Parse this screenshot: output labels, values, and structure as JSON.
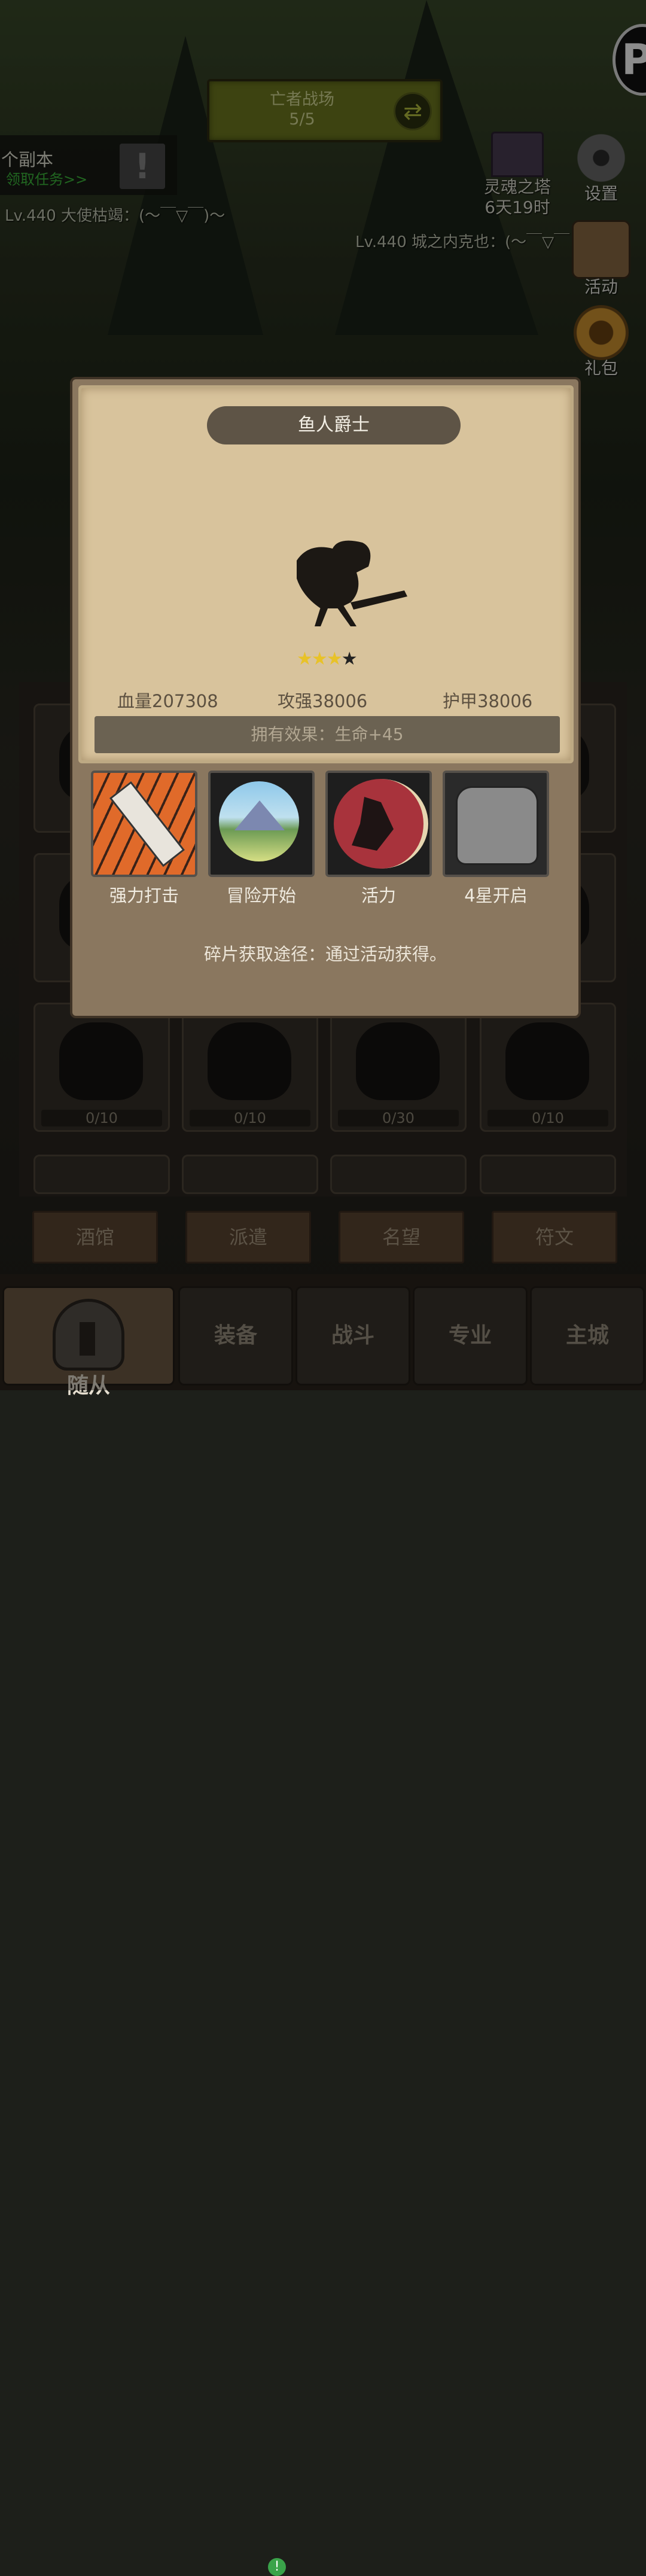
{
  "top_banner": {
    "title": "亡者战场",
    "progress": "5/5"
  },
  "dungeon": {
    "title": "个副本",
    "subtitle": "领取任务>>"
  },
  "chat": [
    "Lv.440 大使枯竭：(～￣▽￣)～",
    "Lv.440 城之内克也：(～￣▽￣"
  ],
  "soul_tower": {
    "label": "灵魂之塔",
    "timer": "6天19时"
  },
  "side_buttons": [
    {
      "label": "设置",
      "icon": "gear-icon"
    },
    {
      "label": "活动",
      "icon": "scroll-icon"
    },
    {
      "label": "礼包",
      "icon": "gift-icon"
    }
  ],
  "grid": {
    "counts": [
      "0/10",
      "0/10",
      "0/30",
      "0/10"
    ]
  },
  "planks": [
    "酒馆",
    "派遣",
    "名望",
    "符文"
  ],
  "bottom_nav": [
    {
      "label": "随从",
      "active": true
    },
    {
      "label": "装备",
      "active": false,
      "badge": "!"
    },
    {
      "label": "战斗",
      "active": false
    },
    {
      "label": "专业",
      "active": false
    },
    {
      "label": "主城",
      "active": false
    }
  ],
  "hero_card": {
    "name": "鱼人爵士",
    "stars_filled": 3,
    "stars_total": 4,
    "hp": "血量207308",
    "attack": "攻强38006",
    "armor": "护甲38006",
    "effect": "拥有效果：生命+45",
    "skills": [
      {
        "label": "强力打击",
        "icon": "sword-strike-icon"
      },
      {
        "label": "冒险开始",
        "icon": "mountain-icon"
      },
      {
        "label": "活力",
        "icon": "vitality-icon"
      },
      {
        "label": "4星开启",
        "icon": "locked-bag-icon"
      }
    ],
    "source": "碎片获取途径：通过活动获得。"
  }
}
